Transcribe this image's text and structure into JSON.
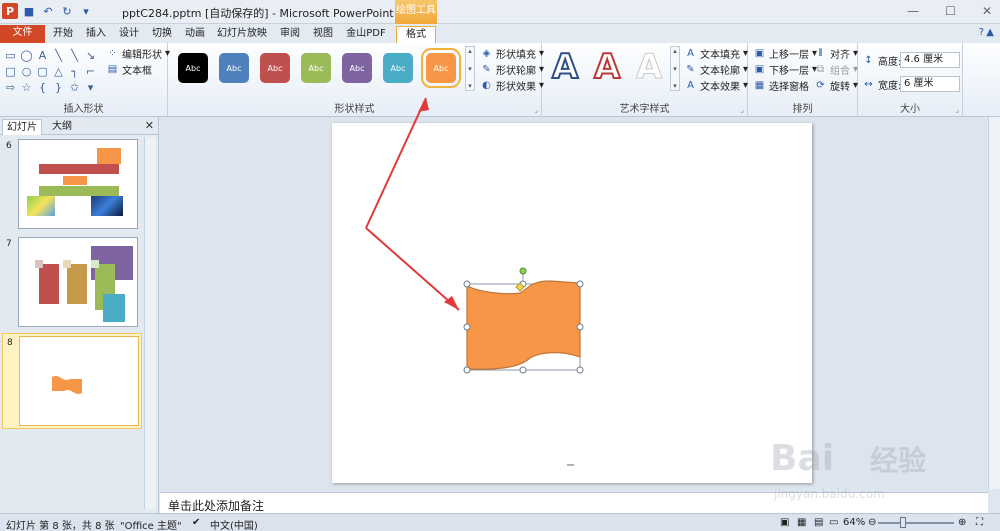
{
  "window": {
    "title": "pptC284.pptm [自动保存的] - Microsoft PowerPoint",
    "context_tools": "绘图工具",
    "controls": [
      "—",
      "☐",
      "✕"
    ]
  },
  "tabs": {
    "file": "文件",
    "items": [
      "开始",
      "插入",
      "设计",
      "切换",
      "动画",
      "幻灯片放映",
      "审阅",
      "视图",
      "金山PDF",
      "格式"
    ],
    "active": "格式"
  },
  "ribbon": {
    "insert_shapes": {
      "label": "插入形状",
      "edit_shape": "编辑形状",
      "text_box": "文本框"
    },
    "shape_styles": {
      "label": "形状样式",
      "swatch_text": "Abc",
      "swatch_colors": [
        "#000000",
        "#4f81bd",
        "#c0504d",
        "#9bbb59",
        "#8064a2",
        "#4bacc6",
        "#f79646"
      ],
      "fill": "形状填充",
      "outline": "形状轮廓",
      "effects": "形状效果"
    },
    "wordart": {
      "label": "艺术字样式",
      "glyph": "A",
      "fill": "文本填充",
      "outline": "文本轮廓",
      "effects": "文本效果"
    },
    "arrange": {
      "label": "排列",
      "bring_forward": "上移一层",
      "send_backward": "下移一层",
      "selection_pane": "选择窗格",
      "align": "对齐",
      "group": "组合",
      "rotate": "旋转"
    },
    "size": {
      "label": "大小",
      "height_label": "高度:",
      "height_value": "4.6 厘米",
      "width_label": "宽度:",
      "width_value": "6 厘米"
    }
  },
  "panel": {
    "tab_slides": "幻灯片",
    "tab_outline": "大纲",
    "close": "✕",
    "slides": [
      {
        "num": "6"
      },
      {
        "num": "7"
      },
      {
        "num": "8",
        "selected": true
      }
    ]
  },
  "slide": {
    "shape_color": "#f79646",
    "shape_border": "#c0763a"
  },
  "notes": {
    "placeholder": "单击此处添加备注"
  },
  "status": {
    "slide_info": "幻灯片 第 8 张，共 8 张",
    "theme": "\"Office 主题\"",
    "language": "中文(中国)",
    "zoom": "64%"
  },
  "watermark": {
    "brand": "Bai",
    "brand2": "经验",
    "url": "jingyan.baidu.com"
  }
}
